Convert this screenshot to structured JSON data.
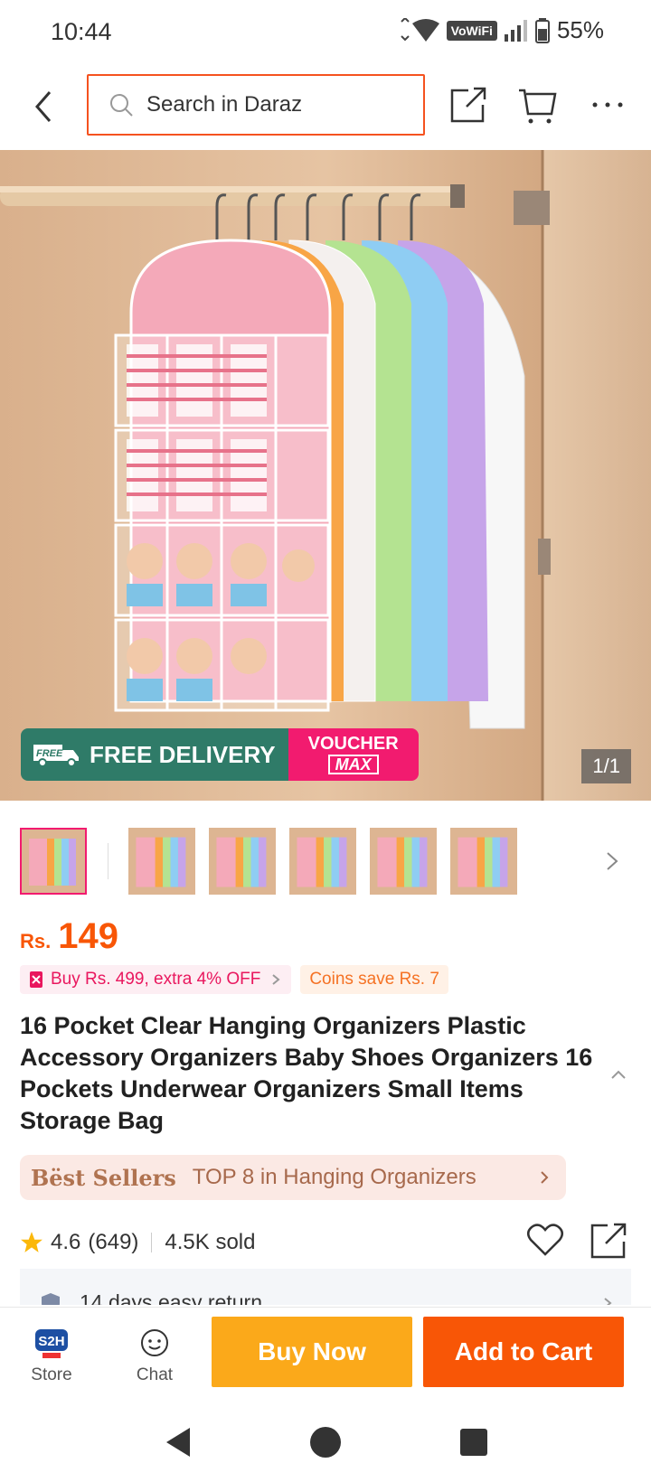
{
  "status_bar": {
    "time": "10:44",
    "vowifi": "VoWiFi",
    "battery": "55%"
  },
  "header": {
    "search_placeholder": "Search in Daraz"
  },
  "hero": {
    "promo_free": "FREE DELIVERY",
    "promo_free_badge": "FREE",
    "promo_voucher_line1": "VOUCHER",
    "promo_voucher_line2": "MAX",
    "page_counter": "1/1"
  },
  "price": {
    "currency": "Rs.",
    "amount": "149"
  },
  "chips": {
    "promo": "Buy Rs. 499, extra 4% OFF",
    "coins": "Coins save Rs. 7"
  },
  "product": {
    "title": "16 Pocket Clear Hanging Organizers Plastic Accessory Organizers Baby Shoes Organizers 16 Pockets Underwear Organizers Small Items Storage Bag"
  },
  "best_sellers": {
    "label": "Bëst Sellers",
    "text": "TOP 8 in Hanging Organizers"
  },
  "rating": {
    "score": "4.6",
    "count": "(649)",
    "sold": "4.5K sold"
  },
  "return_policy": {
    "text": "14 days easy return"
  },
  "bottom_bar": {
    "store_label": "Store",
    "chat_label": "Chat",
    "buy_now": "Buy Now",
    "add_to_cart": "Add to Cart"
  },
  "colors": {
    "brand_orange": "#f85606",
    "buy_now": "#fba91a",
    "accent_pink": "#f21b6f",
    "promo_green": "#2f7b68"
  }
}
